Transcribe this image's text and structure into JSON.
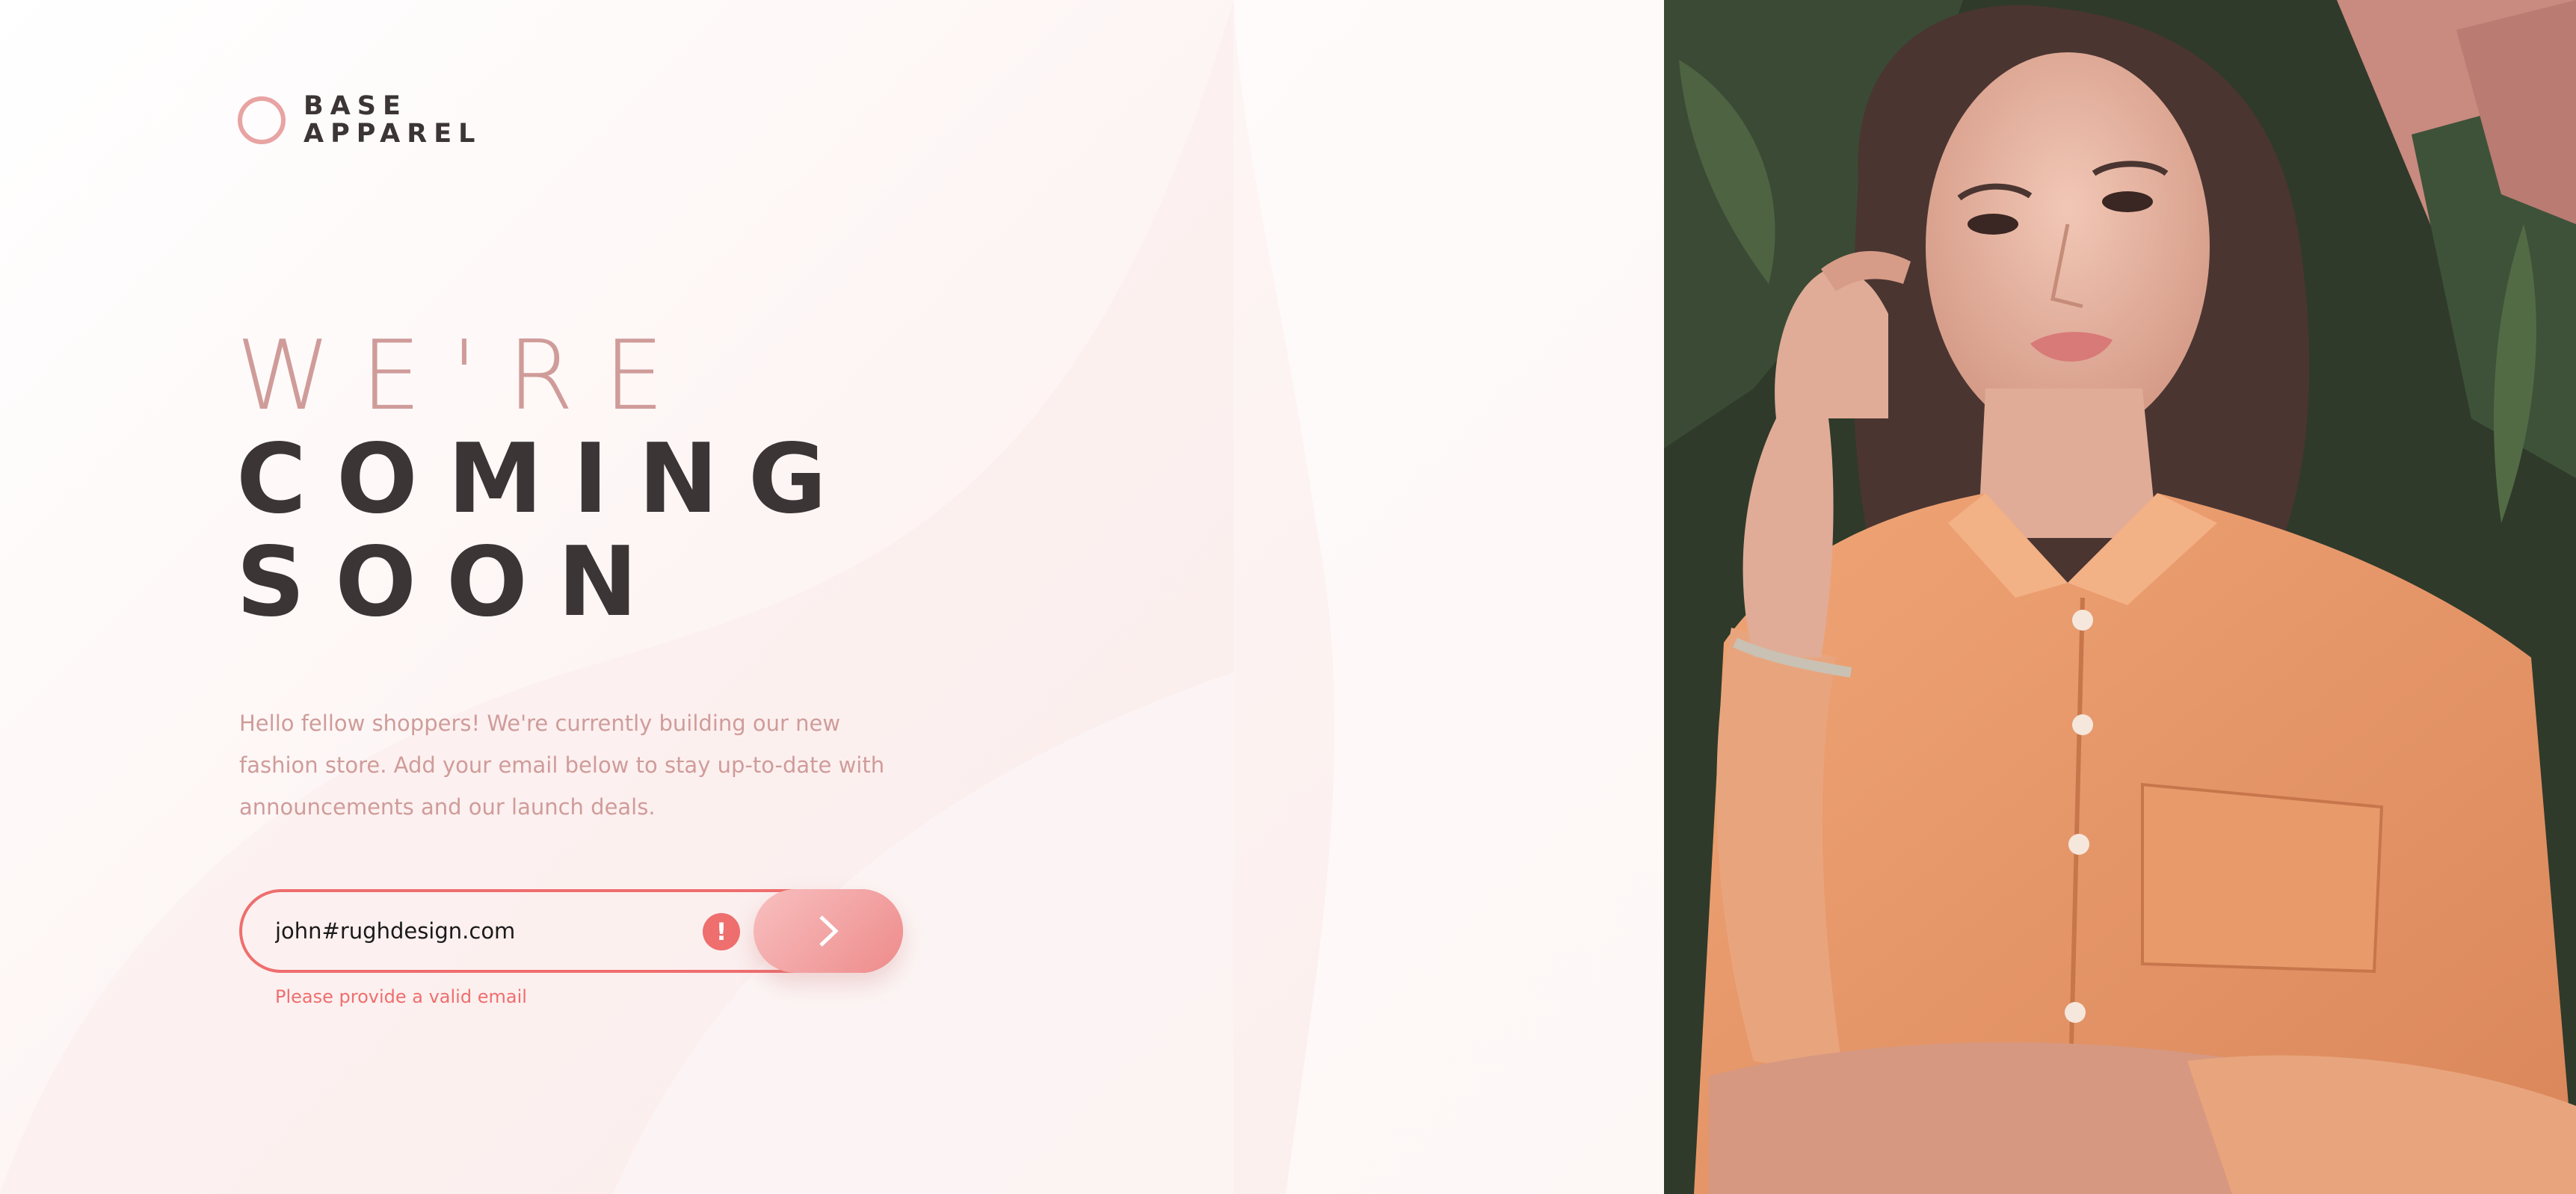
{
  "brand": {
    "line1": "BASE",
    "line2": "APPAREL",
    "accent_color": "#e8a3a3",
    "text_color": "#3c3536"
  },
  "hero": {
    "heading_light": "WE'RE",
    "heading_bold_1": "COMING",
    "heading_bold_2": "SOON"
  },
  "intro": {
    "text": "Hello fellow shoppers! We're currently building our new fashion store. Add your email below to stay up-to-date with announcements and our launch deals."
  },
  "form": {
    "email_value": "john#rughdesign.com",
    "error_icon": "!",
    "error_message": "Please provide a valid email",
    "submit_icon": "chevron-right-icon",
    "error_color": "#ef6e6e"
  },
  "colors": {
    "desaturated_red": "#cf9c9a",
    "dark_grayish_red": "#3c3536",
    "soft_red": "#ef6e6e"
  }
}
